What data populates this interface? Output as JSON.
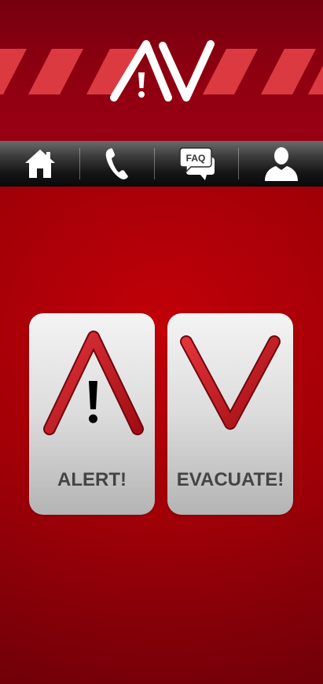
{
  "header": {
    "logo_icon": "av-logo-icon",
    "colors": {
      "background": "#8d0010",
      "stripe": "#dc3a41",
      "logo": "#ffffff"
    }
  },
  "navbar": {
    "items": [
      {
        "name": "home",
        "icon": "home-icon"
      },
      {
        "name": "call",
        "icon": "phone-icon"
      },
      {
        "name": "faq",
        "icon": "faq-icon",
        "icon_text": "FAQ"
      },
      {
        "name": "profile",
        "icon": "user-icon"
      }
    ]
  },
  "actions": {
    "alert": {
      "label": "ALERT!",
      "icon": "alert-icon"
    },
    "evacuate": {
      "label": "EVACUATE!",
      "icon": "evacuate-icon"
    }
  },
  "colors": {
    "accent_red": "#c4161c",
    "card_text": "#444444"
  }
}
